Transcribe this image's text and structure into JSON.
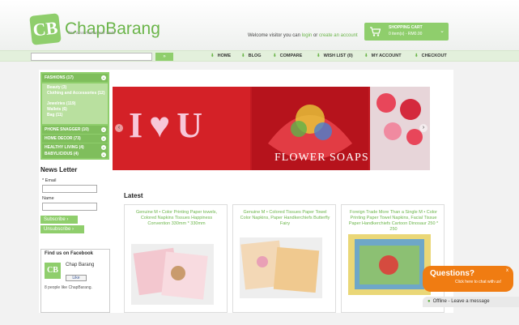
{
  "brand": {
    "name": "ChapBarang",
    "mark": "CB",
    "tagline": "find what makes you smile"
  },
  "header": {
    "welcome_text": "Welcome visitor you can",
    "login_link": "login",
    "or_text": "or",
    "register_link": "create an account"
  },
  "cart": {
    "title": "SHOPPING CART",
    "status": "0 item(s) - RM0.00"
  },
  "search": {
    "placeholder": "",
    "button_label": "»"
  },
  "nav": [
    "HOME",
    "BLOG",
    "COMPARE",
    "WISH LIST (0)",
    "MY ACCOUNT",
    "CHECKOUT"
  ],
  "categories": {
    "fashions": "FASHIONS (17)",
    "fashion_subs": [
      "Beauty (3)",
      "Clothing and Accessories (12)",
      "Jewelries (119)",
      "Wallets (6)",
      "Bag (11)"
    ],
    "others": [
      "PHONE SNAGGER (10)",
      "HOME DECOR (73)",
      "HEALTHY LIVING (4)",
      "BABYLICIOUS (4)"
    ]
  },
  "newsletter": {
    "title": "News Letter",
    "email_label": "* Email",
    "name_label": "Name",
    "subscribe": "Subscribe",
    "unsubscribe": "Unsubscribe"
  },
  "facebook": {
    "title": "Find us on Facebook",
    "page_name": "Chap Barang",
    "like_label": "Like",
    "count_text": "8 people like ChapBarang."
  },
  "banner": {
    "letters": "I♥U",
    "caption": "FLOWER SOAPS"
  },
  "latest": {
    "title": "Latest",
    "products": [
      {
        "name": "Genuine M • Color Printing Paper towels, Colored Napkins Tissues Happiness Convention 330mm * 330mm"
      },
      {
        "name": "Genuine M • Colored Tissues Paper Towel Color Napkins, Paper Handkerchiefs Butterfly Fairy"
      },
      {
        "name": "Foreign Trade More Than a Single M • Color Printing Paper Towel Napkins, Facial Tissue Paper Handkerchiefs Cartoon Dinosaur 250 * 250"
      }
    ]
  },
  "chat": {
    "question": "Questions?",
    "subtext": "Click here to chat with us!",
    "close": "x",
    "offline": "Offline - Leave a message"
  },
  "colors": {
    "brand_green": "#8fce6c",
    "link_green": "#6bb54a",
    "chat_orange": "#f07c12"
  }
}
